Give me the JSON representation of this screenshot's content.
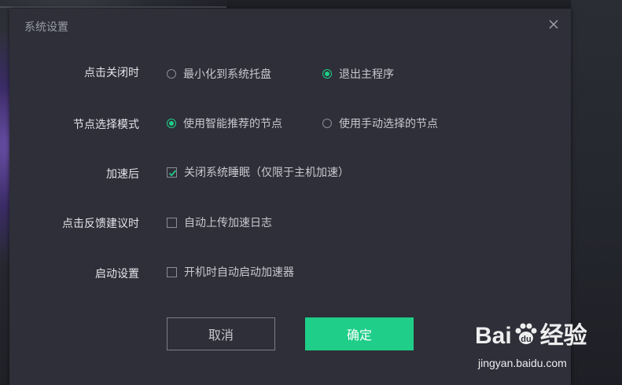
{
  "dialog": {
    "title": "系统设置",
    "close_icon": "close-icon"
  },
  "settings": {
    "close_action": {
      "label": "点击关闭时",
      "options": [
        {
          "label": "最小化到系统托盘",
          "checked": false
        },
        {
          "label": "退出主程序",
          "checked": true
        }
      ]
    },
    "node_mode": {
      "label": "节点选择模式",
      "options": [
        {
          "label": "使用智能推荐的节点",
          "checked": true
        },
        {
          "label": "使用手动选择的节点",
          "checked": false
        }
      ]
    },
    "after_accel": {
      "label": "加速后",
      "option": {
        "label": "关闭系统睡眠（仅限于主机加速）",
        "checked": true
      }
    },
    "feedback": {
      "label": "点击反馈建议时",
      "option": {
        "label": "自动上传加速日志",
        "checked": false
      }
    },
    "startup": {
      "label": "启动设置",
      "option": {
        "label": "开机时自动启动加速器",
        "checked": false
      }
    }
  },
  "buttons": {
    "cancel": "取消",
    "ok": "确定"
  },
  "colors": {
    "accent": "#1fce88",
    "dialog_bg": "#2e2f38"
  },
  "watermark": {
    "logo_left": "Bai",
    "logo_right": "经验",
    "url": "jingyan.baidu.com"
  }
}
